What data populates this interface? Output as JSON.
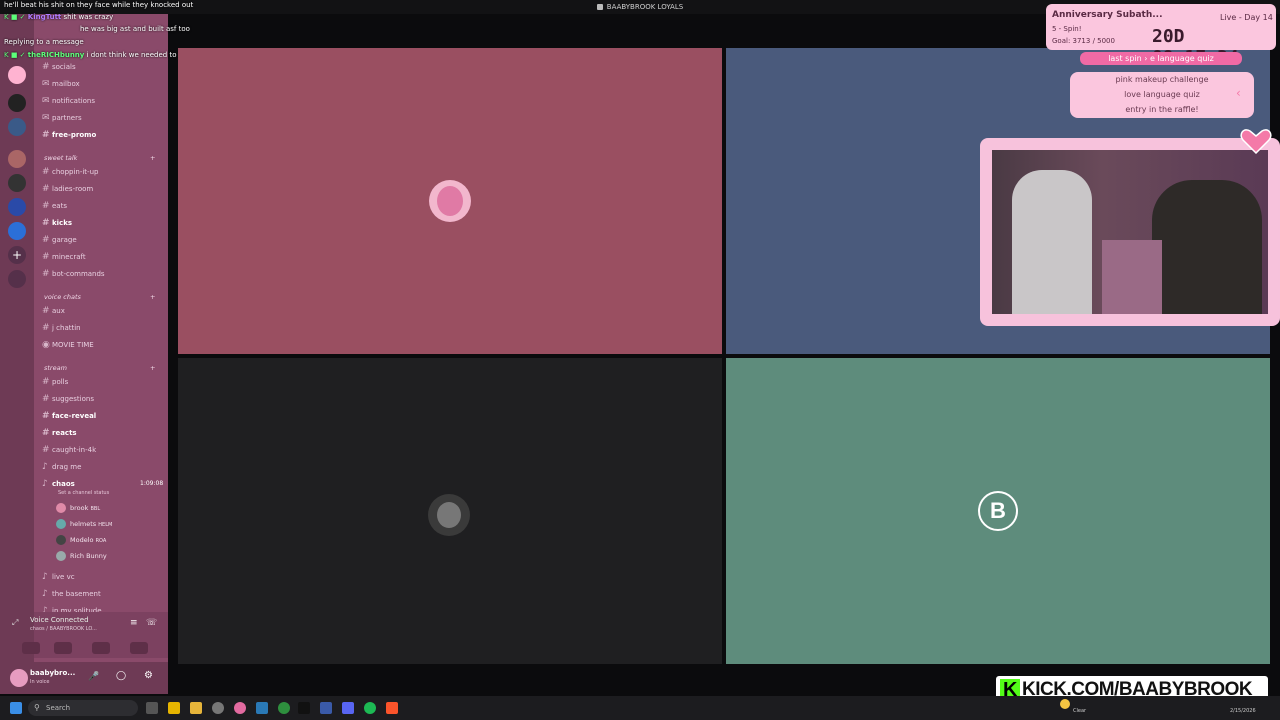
{
  "window": {
    "title": "BAABYBROOK LOYALS"
  },
  "chat": [
    {
      "name": "",
      "text": "he'll beat his shit on they face while they knocked out",
      "color": "#ffffff"
    },
    {
      "name": "KingTutt",
      "text": "shit was crazy",
      "color": "#b07cff"
    },
    {
      "name": "",
      "text": "Replying to a message",
      "color": "#ffffff"
    },
    {
      "name": "theRICHbunny",
      "text": "i dont think we needed to know this",
      "color": "#5cff7a"
    }
  ],
  "chat_partial": "he was big ast and built asf too",
  "sidebar": {
    "channels_top": [
      {
        "label": "socials"
      },
      {
        "label": "mailbox"
      },
      {
        "label": "notifications"
      },
      {
        "label": "partners"
      },
      {
        "label": "free-promo"
      }
    ],
    "category_sweet": "sweet talk",
    "channels_sweet": [
      {
        "label": "choppin-it-up"
      },
      {
        "label": "ladies-room"
      },
      {
        "label": "eats"
      },
      {
        "label": "kicks",
        "bright": true
      },
      {
        "label": "garage"
      },
      {
        "label": "minecraft"
      },
      {
        "label": "bot-commands"
      }
    ],
    "category_voice": "voice chats",
    "channels_voice": [
      {
        "label": "aux"
      },
      {
        "label": "j chattin"
      },
      {
        "label": "MOVIE TIME"
      }
    ],
    "category_stream": "stream",
    "channels_stream": [
      {
        "label": "polls"
      },
      {
        "label": "suggestions"
      },
      {
        "label": "face-reveal",
        "bright": true
      },
      {
        "label": "reacts",
        "bright": true
      },
      {
        "label": "caught-in-4k"
      },
      {
        "label": "drag me"
      }
    ],
    "active_voice": {
      "label": "chaos",
      "time": "1:09:08",
      "status": "Set a channel status"
    },
    "voice_users": [
      {
        "name": "brook",
        "tag": "BBL",
        "color": "#e08aa8"
      },
      {
        "name": "helmets",
        "tag": "HELM",
        "color": "#7aa"
      },
      {
        "name": "Modelo",
        "tag": "ROA",
        "color": "#555"
      },
      {
        "name": "Rich Bunny",
        "tag": "",
        "color": "#9aa"
      }
    ],
    "channels_after": [
      {
        "label": "live vc"
      },
      {
        "label": "the basement"
      },
      {
        "label": "in my solitude"
      }
    ],
    "voice_connected": "Voice Connected",
    "voice_connected_sub": "chaos / BAABYBROOK LO...",
    "user_name": "baabybro...",
    "user_status": "In voice"
  },
  "subathon": {
    "title": "Anniversary Subath...",
    "live_label": "Live - Day 14",
    "spin_label": "5 - Spin!",
    "goal_label": "Goal: 3713 / 5000",
    "timer": "20D 09:17:34"
  },
  "wheel": {
    "last_spin": "last spin  ›  e language quiz",
    "items": [
      "pink makeup challenge",
      "love language quiz",
      "entry in the raffle!"
    ]
  },
  "tiles": {
    "tile4_initial": "B"
  },
  "kick": {
    "text": "KICK.COM/BAABYBROOK"
  },
  "taskbar": {
    "search_placeholder": "Search",
    "weather": "Clear",
    "date": "2/15/2026"
  }
}
